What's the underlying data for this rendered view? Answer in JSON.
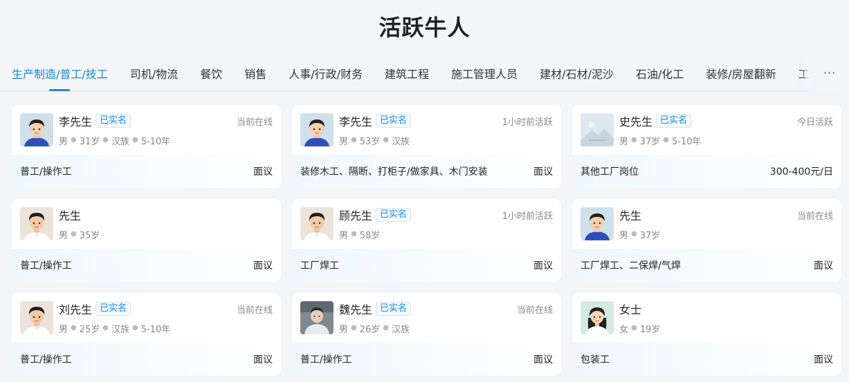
{
  "header": {
    "title": "活跃牛人"
  },
  "tabs": [
    {
      "label": "生产制造/普工/技工",
      "active": true
    },
    {
      "label": "司机/物流"
    },
    {
      "label": "餐饮"
    },
    {
      "label": "销售"
    },
    {
      "label": "人事/行政/财务"
    },
    {
      "label": "建筑工程"
    },
    {
      "label": "施工管理人员"
    },
    {
      "label": "建材/石材/泥沙"
    },
    {
      "label": "石油/化工"
    },
    {
      "label": "装修/房屋翻新"
    },
    {
      "label": "工"
    }
  ],
  "tabs_more": "···",
  "colors": {
    "accent": "#1a8ad8",
    "badge_border": "#cfe5f7"
  },
  "cards": [
    {
      "avatar": "male-cartoon-blue-avatar",
      "name": "李先生",
      "badge": "已实名",
      "status": "当前在线",
      "info": [
        "男",
        "31岁",
        "汉族",
        "5-10年"
      ],
      "job": "普工/操作工",
      "salary": "面议"
    },
    {
      "avatar": "male-cartoon-blue-avatar",
      "name": "李先生",
      "badge": "已实名",
      "status": "1小时前活跃",
      "info": [
        "男",
        "53岁",
        "汉族"
      ],
      "job": "装修木工、隔断、打柜子/做家具、木门安装",
      "salary": "面议"
    },
    {
      "avatar": "placeholder-image-avatar",
      "name": "史先生",
      "badge": "已实名",
      "status": "今日活跃",
      "info": [
        "男",
        "37岁",
        "5-10年"
      ],
      "job": "其他工厂岗位",
      "salary": "300-400元/日"
    },
    {
      "avatar": "male-cartoon-white-avatar",
      "name": "先生",
      "badge": "",
      "status": "",
      "info": [
        "男",
        "35岁"
      ],
      "job": "普工/操作工",
      "salary": "面议"
    },
    {
      "avatar": "male-cartoon-white-avatar",
      "name": "顾先生",
      "badge": "已实名",
      "status": "1小时前活跃",
      "info": [
        "男",
        "58岁"
      ],
      "job": "工厂焊工",
      "salary": "面议"
    },
    {
      "avatar": "male-cartoon-blue-avatar",
      "name": "先生",
      "badge": "",
      "status": "当前在线",
      "info": [
        "男",
        "37岁"
      ],
      "job": "工厂焊工、二保焊/气焊",
      "salary": "面议"
    },
    {
      "avatar": "male-cartoon-white-avatar",
      "name": "刘先生",
      "badge": "已实名",
      "status": "当前在线",
      "info": [
        "男",
        "25岁",
        "汉族",
        "5-10年"
      ],
      "job": "普工/操作工",
      "salary": "面议"
    },
    {
      "avatar": "photo-avatar",
      "name": "魏先生",
      "badge": "已实名",
      "status": "当前在线",
      "info": [
        "男",
        "26岁",
        "汉族"
      ],
      "job": "普工/操作工",
      "salary": "面议"
    },
    {
      "avatar": "female-cartoon-avatar",
      "name": "女士",
      "badge": "",
      "status": "",
      "info": [
        "女",
        "19岁"
      ],
      "job": "包装工",
      "salary": "面议"
    }
  ]
}
